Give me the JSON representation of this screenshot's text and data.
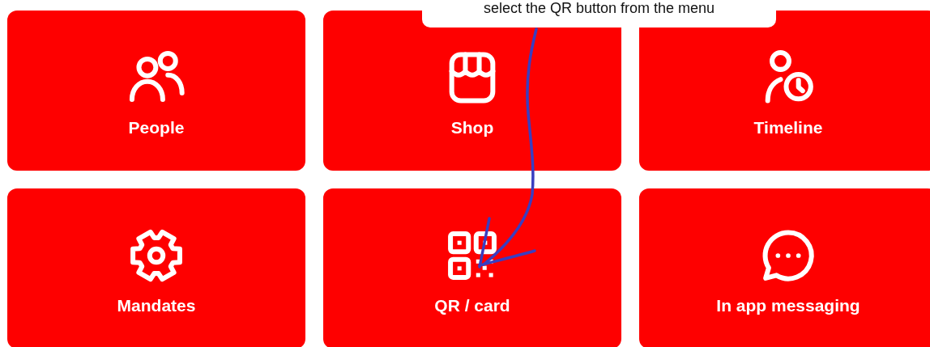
{
  "tooltip": {
    "text": "select the QR button from the menu"
  },
  "tiles": [
    {
      "label": "People",
      "kind": "people"
    },
    {
      "label": "Shop",
      "kind": "shop"
    },
    {
      "label": "Timeline",
      "kind": "timeline"
    },
    {
      "label": "Mandates",
      "kind": "gear"
    },
    {
      "label": "QR / card",
      "kind": "qr"
    },
    {
      "label": "In app messaging",
      "kind": "message"
    }
  ]
}
